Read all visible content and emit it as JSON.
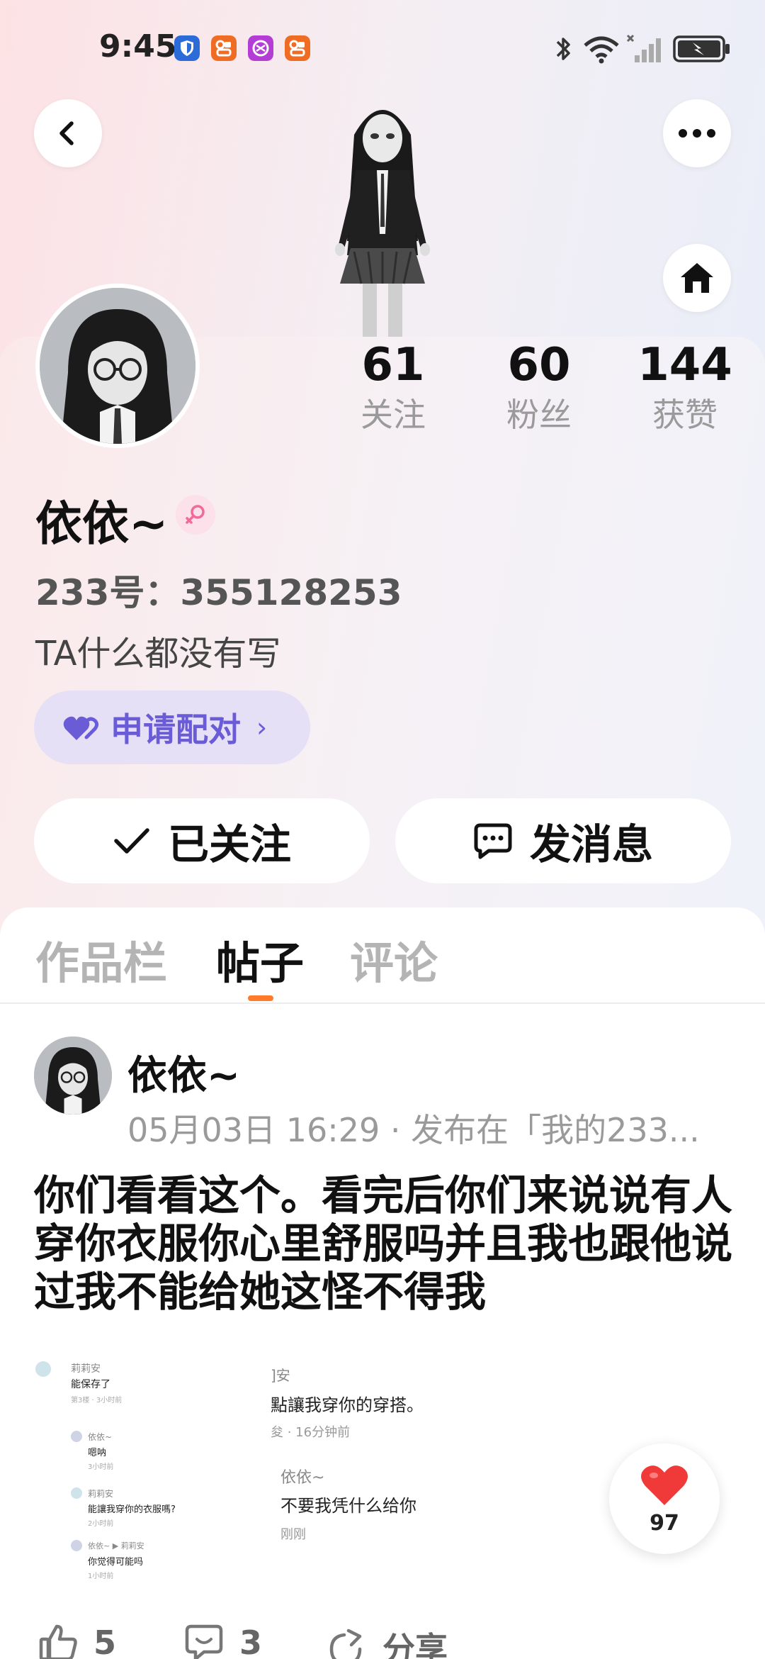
{
  "status_bar": {
    "time": "9:45",
    "app_icons": [
      "shield-app-icon",
      "orange-app-icon",
      "purple-app-icon",
      "orange-app-icon"
    ],
    "colors": {
      "shield": "#2d6bd8",
      "orange": "#ef6c24",
      "purple": "#b43dd6"
    }
  },
  "profile": {
    "stats": [
      {
        "value": "61",
        "label": "关注"
      },
      {
        "value": "60",
        "label": "粉丝"
      },
      {
        "value": "144",
        "label": "获赞"
      }
    ],
    "username": "依依~",
    "uid": "233号：355128253",
    "bio": "TA什么都没有写",
    "pair_button": "申请配对",
    "follow_button": "已关注",
    "message_button": "发消息"
  },
  "tabs": [
    {
      "label": "作品栏",
      "active": false
    },
    {
      "label": "帖子",
      "active": true
    },
    {
      "label": "评论",
      "active": false
    }
  ],
  "post": {
    "author": "依依~",
    "meta": "05月03日 16:29 · 发布在「我的233...",
    "text": "你们看看这个。看完后你们来说说有人穿你衣服你心里舒服吗并且我也跟他说过我不能给她这怪不得我",
    "screenshot_left": {
      "n1": "莉莉安",
      "t1": "能保存了",
      "s1": "第3楼 · 3小时前",
      "n2": "依依~",
      "t2": "嗯呐",
      "s2": "3小时前",
      "n3": "莉莉安",
      "t3": "能讓我穿你的衣服嗎?",
      "s3": "2小时前",
      "n4": "依依~ ▶ 莉莉安",
      "t4": "你觉得可能吗",
      "s4": "1小时前"
    },
    "screenshot_right": {
      "l1": "]安",
      "l2": "點讓我穿你的穿搭。",
      "l3": "夋 · 16分钟前",
      "l4": "依依~",
      "l5": "不要我凭什么给你",
      "l6": "刚刚"
    },
    "like_count": "97",
    "actions": {
      "likes": "5",
      "comments": "3",
      "share": "分享"
    }
  },
  "colors": {
    "accent_orange": "#ff7a2b",
    "pair_purple": "#6a5cd6",
    "heart_red": "#f03a3a"
  }
}
